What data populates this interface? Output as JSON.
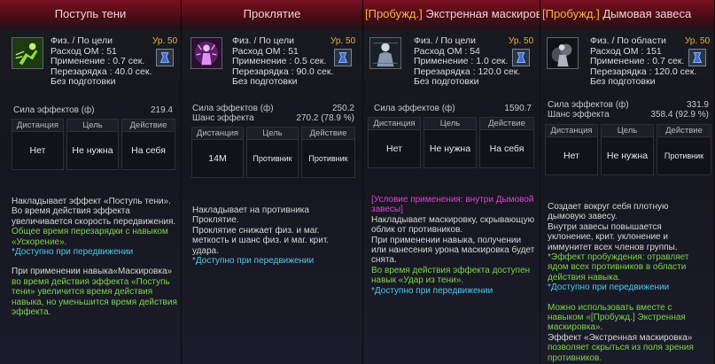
{
  "panels": [
    {
      "title": "Поступь тени",
      "level": "Ур. 50",
      "stats": [
        "Физ. / По цели",
        "Расход ОМ : 51",
        "Применение : 0.7 сек.",
        "Перезарядка : 40.0 сек.",
        "Без подготовки"
      ],
      "effect_rows": [
        {
          "label": "Сила эффектов (ф)",
          "value": "219.4"
        }
      ],
      "cells": [
        {
          "header": "Дистанция",
          "value": "Нет"
        },
        {
          "header": "Цель",
          "value": "Не нужна"
        },
        {
          "header": "Действие",
          "value": "На себя"
        }
      ],
      "desc": {
        "p1": "Накладывает эффект «Поступь тени».",
        "p2": "Во время действия эффекта увеличивается скорость передвижения.",
        "green1": "Общее время перезарядки с навыком «Ускорение».",
        "cyan1": "*Доступно при передвижении",
        "p3": "При применении навыка«Маскировка»",
        "green2": "во время действия эффекта «Поступь тени» увеличится время действия навыка, но уменьшится время действия эффекта."
      }
    },
    {
      "title": "Проклятие",
      "level": "Ур. 50",
      "stats": [
        "Физ. / По цели",
        "Расход ОМ : 51",
        "Применение : 0.5 сек.",
        "Перезарядка : 90.0 сек.",
        "Без подготовки"
      ],
      "effect_rows": [
        {
          "label": "Сила эффектов (ф)",
          "value": "250.2"
        },
        {
          "label": "Шанс эффекта",
          "value": "270.2 (78.9 %)"
        }
      ],
      "cells": [
        {
          "header": "Дистанция",
          "value": "14М"
        },
        {
          "header": "Цель",
          "value": "Противник"
        },
        {
          "header": "Действие",
          "value": "Противник"
        }
      ],
      "desc": {
        "p1": "Накладывает на противника Проклятие.",
        "p2": "Проклятие снижает физ. и маг. меткость и шанс физ. и маг. крит. удара.",
        "cyan1": "*Доступно при передвижении"
      }
    },
    {
      "title_tag": "[Пробужд.]",
      "title": "Экстренная маскировка",
      "level": "Ур. 50",
      "stats": [
        "Физ. / По цели",
        "Расход ОМ : 54",
        "Применение : 1.0 сек.",
        "Перезарядка : 120.0 сек.",
        "Без подготовки"
      ],
      "effect_rows": [
        {
          "label": "Сила эффектов (ф)",
          "value": "1590.7"
        }
      ],
      "cells": [
        {
          "header": "Дистанция",
          "value": "Нет"
        },
        {
          "header": "Цель",
          "value": "Не нужна"
        },
        {
          "header": "Действие",
          "value": "На себя"
        }
      ],
      "desc": {
        "magenta1": "[Условие применения: внутри Дымовой завесы]",
        "p1": "Накладывает маскировку, скрывающую облик от противников.",
        "p2": "При применении навыка, получении или нанесения урона маскировка будет снята.",
        "green1": "Во время действия эффекта доступен навык «Удар из тени».",
        "cyan1": "*Доступно при передвижении"
      }
    },
    {
      "title_tag": "[Пробужд.]",
      "title": "Дымовая завеса",
      "level": "Ур. 50",
      "stats": [
        "Физ. / По области",
        "Расход ОМ : 151",
        "Применение : 0.7 сек.",
        "Перезарядка : 120.0 сек.",
        "Без подготовки"
      ],
      "effect_rows": [
        {
          "label": "Сила эффектов (ф)",
          "value": "331.9"
        },
        {
          "label": "Шанс эффекта",
          "value": "358.4 (92.9 %)"
        }
      ],
      "cells": [
        {
          "header": "Дистанция",
          "value": "Нет"
        },
        {
          "header": "Цель",
          "value": "Не нужна"
        },
        {
          "header": "Действие",
          "value": "Противник"
        }
      ],
      "desc": {
        "p1": "Создает вокруг себя плотную дымовую завесу.",
        "p2": "Внутри завесы повышается уклонение, крит. уклонение и иммунитет всех членов группы.",
        "green1": "*Эффект пробуждения: отравляет ядом всех противников в области действия навыка.",
        "cyan1": "*Доступно при передвижении",
        "green2": "Можно использовать вместе с навыком «[Пробужд.] Экстренная маскировка».",
        "p3": "Эффект «Экстренная маскировка»",
        "green3": "позволяет скрыться из поля зрения противников."
      }
    }
  ]
}
